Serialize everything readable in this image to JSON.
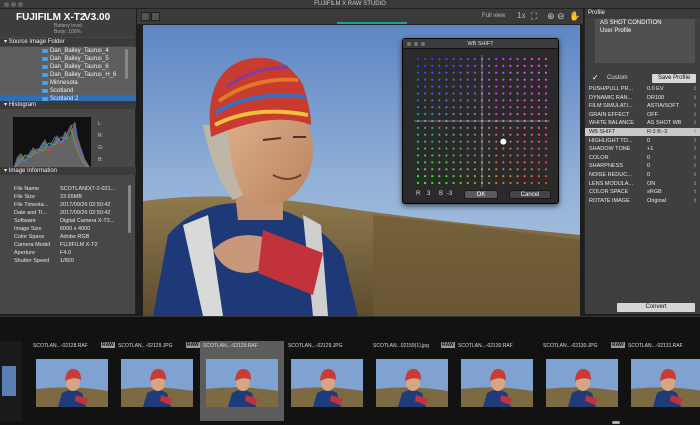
{
  "window": {
    "title": "FUJIFILM X RAW STUDIO"
  },
  "camera": {
    "model": "FUJIFILM X-T2",
    "version": "V3.00",
    "battery": "Battery level:",
    "body": "Body: 100%"
  },
  "left": {
    "source_header": "Source Image Folder",
    "folders": [
      {
        "label": "Dan_Bailey_Taurus_4",
        "selected": false
      },
      {
        "label": "Dan_Bailey_Taurus_5",
        "selected": false
      },
      {
        "label": "Dan_Bailey_Taurus_6",
        "selected": false
      },
      {
        "label": "Dan_Bailey_Taurus_H_6",
        "selected": false
      },
      {
        "label": "Minnesota",
        "selected": false
      },
      {
        "label": "Scotland",
        "selected": false
      },
      {
        "label": "Scotland 2",
        "selected": true
      }
    ],
    "histogram_header": "Histogram",
    "histogram_labels": [
      "L:",
      "R:",
      "G:",
      "B:"
    ],
    "info_header": "Image Information",
    "info": [
      {
        "k": "File Name",
        "v": "SCOTLAND(7-2-021..."
      },
      {
        "k": "File Size",
        "v": "23.65MB"
      },
      {
        "k": "File Timesta...",
        "v": "2017/09/26 02:50:42"
      },
      {
        "k": "Date and Ti...",
        "v": "2017/09/26 02:50:42"
      },
      {
        "k": "Software",
        "v": "Digital Camera X-T2..."
      },
      {
        "k": "Image Size",
        "v": "6000 x 4000"
      },
      {
        "k": "Color Space",
        "v": "Adobe RGB"
      },
      {
        "k": "Camera Model",
        "v": "FUJIFILM X-T2"
      },
      {
        "k": "Aperture",
        "v": "F4.0"
      },
      {
        "k": "Shutter Speed",
        "v": "1/800"
      }
    ]
  },
  "toolbar": {
    "fullview": "Full view",
    "zoom_label": "1x"
  },
  "wb_dialog": {
    "title": "WB SHIFT",
    "r_label": "R",
    "r_value": "3",
    "b_label": "B",
    "b_value": "-3",
    "ok": "OK",
    "cancel": "Cancel"
  },
  "right": {
    "header": "Profile",
    "profiles": [
      "AS SHOT CONDITION",
      "User Profile"
    ],
    "custom_label": "Custom",
    "save_profile": "Save Profile",
    "params": [
      {
        "k": "PUSH/PULL PR...",
        "v": "0.0 EV",
        "sel": false
      },
      {
        "k": "DYNAMIC RAN...",
        "v": "DR100",
        "sel": false
      },
      {
        "k": "FILM SIMULATI...",
        "v": "ASTIA/SOFT",
        "sel": false
      },
      {
        "k": "GRAIN EFFECT",
        "v": "OFF",
        "sel": false
      },
      {
        "k": "WHITE BALANCE",
        "v": "AS SHOT WB",
        "sel": false
      },
      {
        "k": "WB SHIFT",
        "v": "R:3 B:-3",
        "sel": true
      },
      {
        "k": "HIGHLIGHT TO...",
        "v": "0",
        "sel": false
      },
      {
        "k": "SHADOW TONE",
        "v": "+1",
        "sel": false
      },
      {
        "k": "COLOR",
        "v": "0",
        "sel": false
      },
      {
        "k": "SHARPNESS",
        "v": "0",
        "sel": false
      },
      {
        "k": "NOISE REDUC...",
        "v": "0",
        "sel": false
      },
      {
        "k": "LENS MODULA...",
        "v": "ON",
        "sel": false
      },
      {
        "k": "COLOR SPACE",
        "v": "sRGB",
        "sel": false
      },
      {
        "k": "ROTATE IMAGE",
        "v": "Original",
        "sel": false
      }
    ],
    "convert": "Convert"
  },
  "filmstrip": {
    "thumbs": [
      {
        "label": "SCOTLAN...-02128.RAF",
        "raw": false,
        "selected": false
      },
      {
        "label": "SCOTLAN...-02129.JPG",
        "raw": true,
        "selected": false
      },
      {
        "label": "SCOTLAN...-02129.RAF",
        "raw": true,
        "selected": true
      },
      {
        "label": "SCOTLAN...-02129.JPG",
        "raw": false,
        "selected": false
      },
      {
        "label": "SCOTLAN...02159(1).jpg",
        "raw": false,
        "selected": false
      },
      {
        "label": "SCOTLAN...-02130.RAF",
        "raw": true,
        "selected": false
      },
      {
        "label": "SCOTLAN...-02130.JPG",
        "raw": false,
        "selected": false
      },
      {
        "label": "SCOTLAN...-02131.RAF",
        "raw": true,
        "selected": false
      }
    ]
  }
}
